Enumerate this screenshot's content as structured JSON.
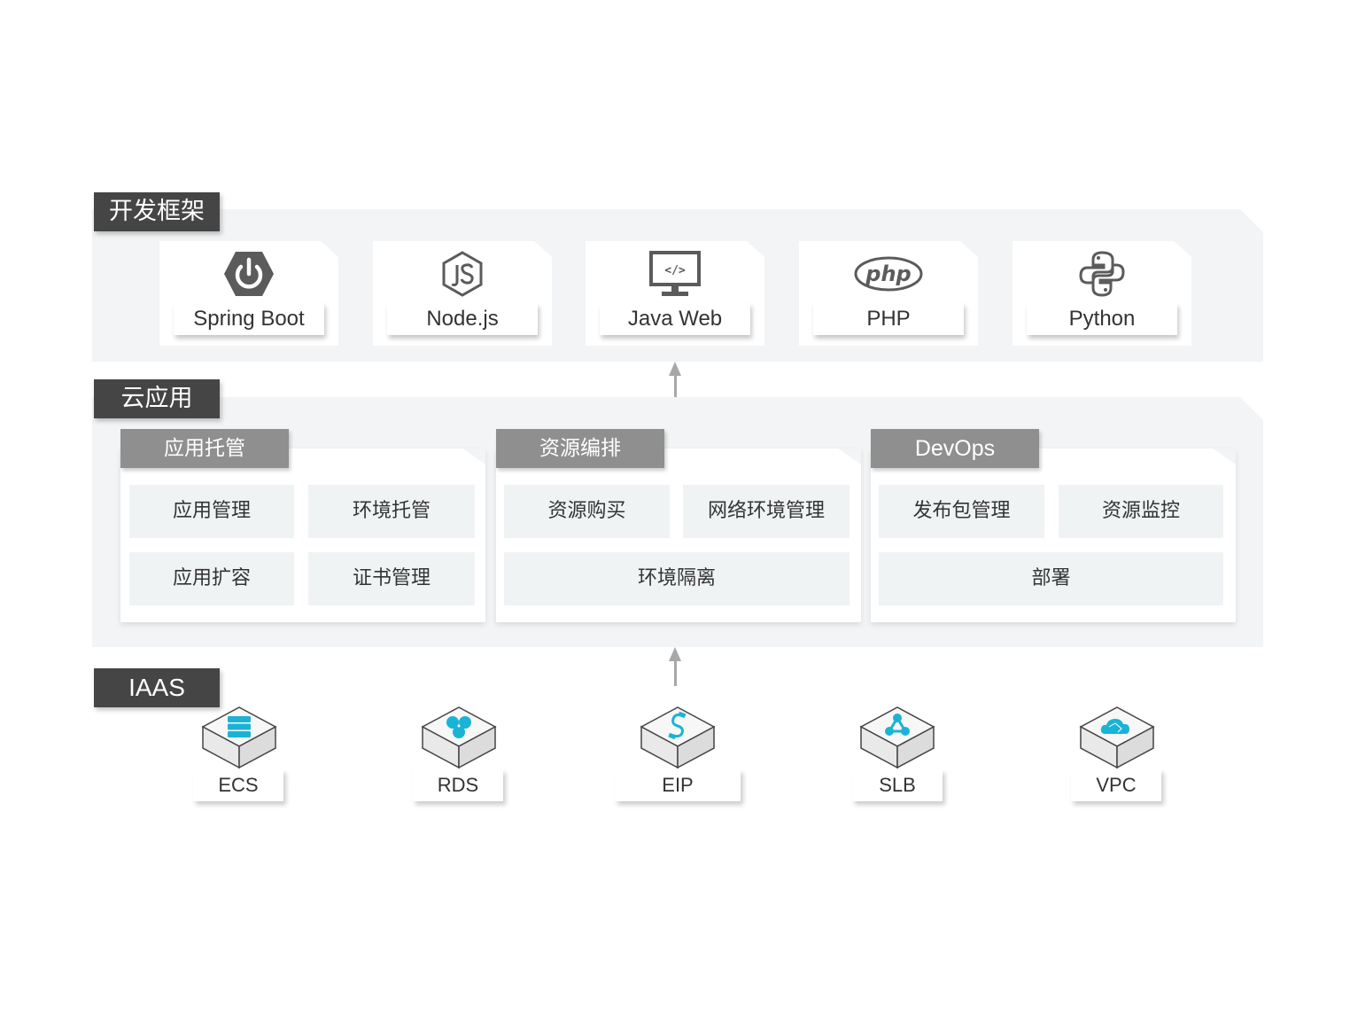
{
  "layers": {
    "framework": {
      "title": "开发框架",
      "items": [
        {
          "label": "Spring Boot",
          "icon": "spring-boot-icon"
        },
        {
          "label": "Node.js",
          "icon": "nodejs-icon"
        },
        {
          "label": "Java Web",
          "icon": "java-web-monitor-icon"
        },
        {
          "label": "PHP",
          "icon": "php-icon"
        },
        {
          "label": "Python",
          "icon": "python-icon"
        }
      ]
    },
    "cloud_app": {
      "title": "云应用",
      "groups": [
        {
          "title": "应用托管",
          "cells": [
            "应用管理",
            "环境托管",
            "应用扩容",
            "证书管理"
          ]
        },
        {
          "title": "资源编排",
          "cells": [
            "资源购买",
            "网络环境管理",
            "环境隔离"
          ]
        },
        {
          "title": "DevOps",
          "cells": [
            "发布包管理",
            "资源监控",
            "部署"
          ]
        }
      ]
    },
    "iaas": {
      "title": "IAAS",
      "items": [
        {
          "label": "ECS",
          "icon": "server-icon"
        },
        {
          "label": "RDS",
          "icon": "database-icon"
        },
        {
          "label": "EIP",
          "icon": "cable-icon"
        },
        {
          "label": "SLB",
          "icon": "load-balancer-icon"
        },
        {
          "label": "VPC",
          "icon": "cloud-network-icon"
        }
      ]
    }
  },
  "colors": {
    "layer_tag": "#454545",
    "group_tag": "#8f8f8f",
    "layer_bg": "#f2f4f5",
    "cell_bg": "#f0f3f4",
    "icon_gray": "#5b5b5b",
    "iaas_accent": "#1ab3d6",
    "arrow": "#a8a8a8"
  }
}
